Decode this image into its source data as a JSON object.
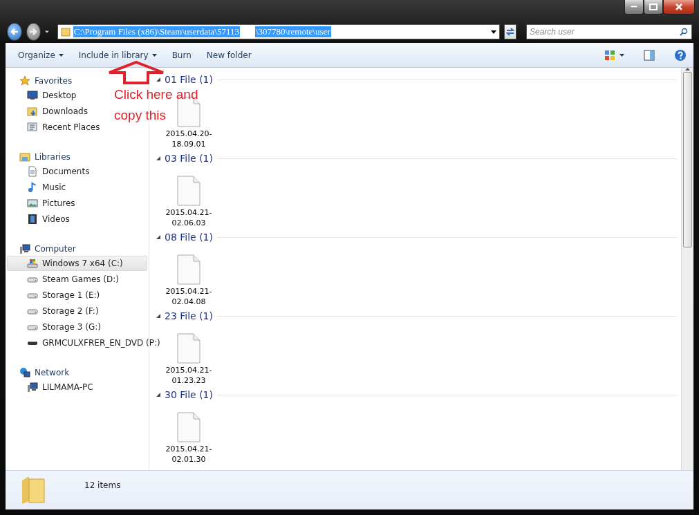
{
  "address": {
    "start": "C:\\Program Files (x86)\\Steam\\userdata\\57113",
    "end": "\\307780\\remote\\user",
    "selected": true
  },
  "search": {
    "placeholder": "Search user"
  },
  "toolbar": [
    {
      "label": "Organize",
      "dropdown": true
    },
    {
      "label": "Include in library",
      "dropdown": true
    },
    {
      "label": "Burn",
      "dropdown": false
    },
    {
      "label": "New folder",
      "dropdown": false
    }
  ],
  "sidebar": [
    {
      "label": "Favorites",
      "kind": "star",
      "children": [
        {
          "label": "Desktop",
          "kind": "desktop",
          "selected": false
        },
        {
          "label": "Downloads",
          "kind": "downloads",
          "selected": false
        },
        {
          "label": "Recent Places",
          "kind": "recent",
          "selected": false
        }
      ]
    },
    {
      "label": "Libraries",
      "kind": "library",
      "children": [
        {
          "label": "Documents",
          "kind": "document",
          "selected": false
        },
        {
          "label": "Music",
          "kind": "music",
          "selected": false
        },
        {
          "label": "Pictures",
          "kind": "pictures",
          "selected": false
        },
        {
          "label": "Videos",
          "kind": "videos",
          "selected": false
        }
      ]
    },
    {
      "label": "Computer",
      "kind": "computer",
      "children": [
        {
          "label": "Windows 7 x64 (C:)",
          "kind": "windrive",
          "selected": true
        },
        {
          "label": "Steam Games (D:)",
          "kind": "drive",
          "selected": false
        },
        {
          "label": "Storage 1 (E:)",
          "kind": "drive",
          "selected": false
        },
        {
          "label": "Storage 2 (F:)",
          "kind": "drive",
          "selected": false
        },
        {
          "label": "Storage 3 (G:)",
          "kind": "drive",
          "selected": false
        },
        {
          "label": "GRMCULXFRER_EN_DVD (P:)",
          "kind": "dvd",
          "selected": false
        }
      ]
    },
    {
      "label": "Network",
      "kind": "network",
      "children": [
        {
          "label": "LILMAMA-PC",
          "kind": "computer",
          "selected": false
        }
      ]
    }
  ],
  "groups": [
    {
      "title": "01 File (1)",
      "expanded": true,
      "files": [
        {
          "name": "2015.04.20-\n18.09.01"
        }
      ]
    },
    {
      "title": "03 File (1)",
      "expanded": true,
      "files": [
        {
          "name": "2015.04.21-\n02.06.03"
        }
      ]
    },
    {
      "title": "08 File (1)",
      "expanded": true,
      "files": [
        {
          "name": "2015.04.21-\n02.04.08"
        }
      ]
    },
    {
      "title": "23 File (1)",
      "expanded": true,
      "files": [
        {
          "name": "2015.04.21-\n01.23.23"
        }
      ]
    },
    {
      "title": "30 File (1)",
      "expanded": true,
      "files": [
        {
          "name": "2015.04.21-\n02.01.30"
        }
      ]
    }
  ],
  "annotation": {
    "lines": [
      "Click here and",
      "copy this"
    ]
  },
  "status_bar": {
    "count": "12 items"
  }
}
